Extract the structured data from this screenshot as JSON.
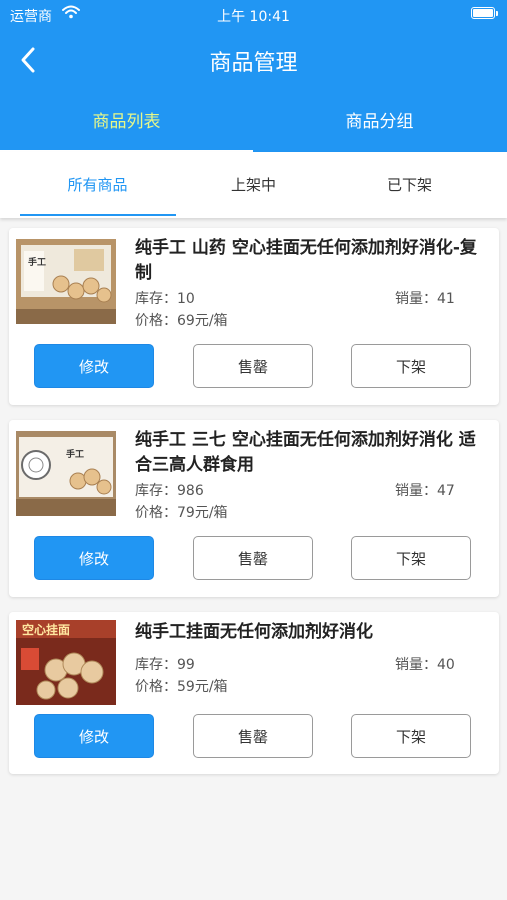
{
  "status_bar": {
    "carrier": "运营商",
    "time": "上午 10:41"
  },
  "nav": {
    "title": "商品管理"
  },
  "top_tabs": [
    {
      "label": "商品列表"
    },
    {
      "label": "商品分组"
    }
  ],
  "sub_tabs": [
    {
      "label": "所有商品"
    },
    {
      "label": "上架中"
    },
    {
      "label": "已下架"
    }
  ],
  "colors": {
    "primary": "#2196f3",
    "active_top_tab": "#e6f78a"
  },
  "products": [
    {
      "name": "纯手工 山药 空心挂面无任何添加剂好消化-复制",
      "stock": "库存：10",
      "sales": "销量：41",
      "price": "价格：69元/箱",
      "image_text": "手工"
    },
    {
      "name": "纯手工 三七 空心挂面无任何添加剂好消化 适合三高人群食用",
      "stock": "库存：986",
      "sales": "销量：47",
      "price": "价格：79元/箱",
      "image_text": "手工"
    },
    {
      "name": "纯手工挂面无任何添加剂好消化",
      "stock": "库存：99",
      "sales": "销量：40",
      "price": "价格：59元/箱",
      "image_text": "空心挂面"
    }
  ],
  "buttons": {
    "edit": "修改",
    "sold_out": "售罄",
    "off_shelf": "下架"
  }
}
